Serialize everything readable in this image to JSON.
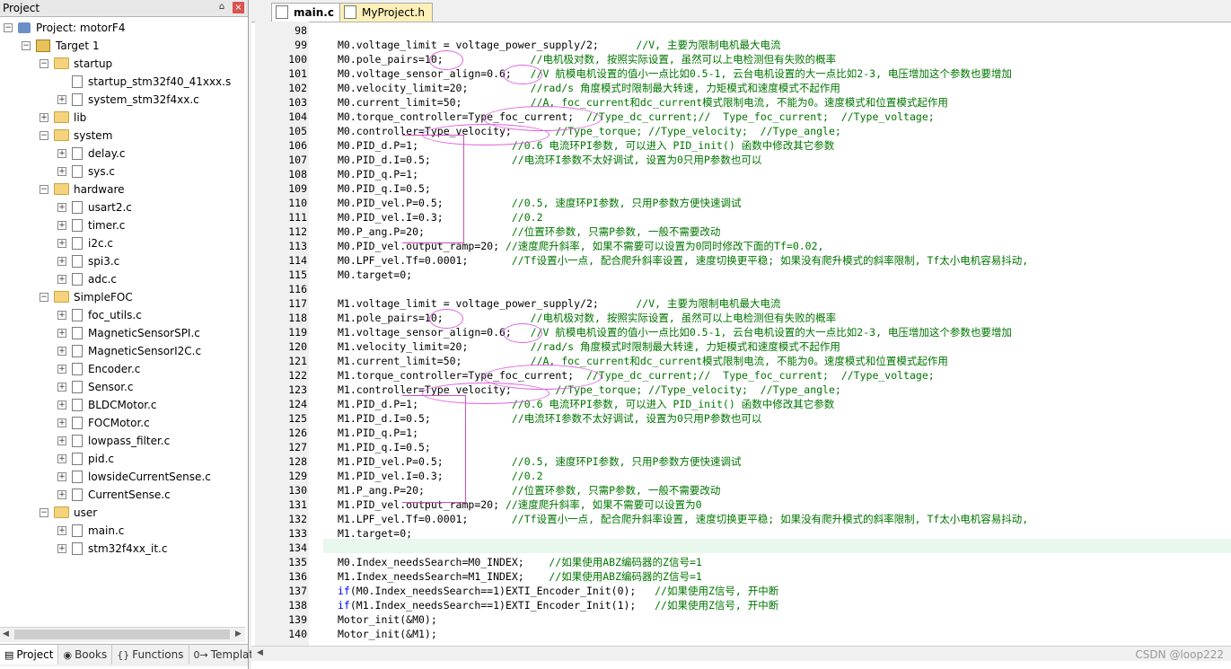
{
  "project_panel": {
    "title": "Project",
    "pin_label": "⌂",
    "close_label": "×",
    "tree": [
      {
        "level": 0,
        "type": "project",
        "label": "Project: motorF4",
        "toggle": "-"
      },
      {
        "level": 1,
        "type": "target",
        "label": "Target 1",
        "toggle": "-"
      },
      {
        "level": 2,
        "type": "folder",
        "label": "startup",
        "toggle": "-"
      },
      {
        "level": 3,
        "type": "file",
        "label": "startup_stm32f40_41xxx.s",
        "toggle": ""
      },
      {
        "level": 3,
        "type": "file",
        "label": "system_stm32f4xx.c",
        "toggle": "+"
      },
      {
        "level": 2,
        "type": "folder",
        "label": "lib",
        "toggle": "+"
      },
      {
        "level": 2,
        "type": "folder",
        "label": "system",
        "toggle": "-"
      },
      {
        "level": 3,
        "type": "file",
        "label": "delay.c",
        "toggle": "+"
      },
      {
        "level": 3,
        "type": "file",
        "label": "sys.c",
        "toggle": "+"
      },
      {
        "level": 2,
        "type": "folder",
        "label": "hardware",
        "toggle": "-"
      },
      {
        "level": 3,
        "type": "file",
        "label": "usart2.c",
        "toggle": "+"
      },
      {
        "level": 3,
        "type": "file",
        "label": "timer.c",
        "toggle": "+"
      },
      {
        "level": 3,
        "type": "file",
        "label": "i2c.c",
        "toggle": "+"
      },
      {
        "level": 3,
        "type": "file",
        "label": "spi3.c",
        "toggle": "+"
      },
      {
        "level": 3,
        "type": "file",
        "label": "adc.c",
        "toggle": "+"
      },
      {
        "level": 2,
        "type": "folder",
        "label": "SimpleFOC",
        "toggle": "-"
      },
      {
        "level": 3,
        "type": "file",
        "label": "foc_utils.c",
        "toggle": "+"
      },
      {
        "level": 3,
        "type": "file",
        "label": "MagneticSensorSPI.c",
        "toggle": "+"
      },
      {
        "level": 3,
        "type": "file",
        "label": "MagneticSensorI2C.c",
        "toggle": "+"
      },
      {
        "level": 3,
        "type": "file",
        "label": "Encoder.c",
        "toggle": "+"
      },
      {
        "level": 3,
        "type": "file",
        "label": "Sensor.c",
        "toggle": "+"
      },
      {
        "level": 3,
        "type": "file",
        "label": "BLDCMotor.c",
        "toggle": "+"
      },
      {
        "level": 3,
        "type": "file",
        "label": "FOCMotor.c",
        "toggle": "+"
      },
      {
        "level": 3,
        "type": "file",
        "label": "lowpass_filter.c",
        "toggle": "+"
      },
      {
        "level": 3,
        "type": "file",
        "label": "pid.c",
        "toggle": "+"
      },
      {
        "level": 3,
        "type": "file",
        "label": "lowsideCurrentSense.c",
        "toggle": "+"
      },
      {
        "level": 3,
        "type": "file",
        "label": "CurrentSense.c",
        "toggle": "+"
      },
      {
        "level": 2,
        "type": "folder",
        "label": "user",
        "toggle": "-"
      },
      {
        "level": 3,
        "type": "file",
        "label": "main.c",
        "toggle": "+"
      },
      {
        "level": 3,
        "type": "file",
        "label": "stm32f4xx_it.c",
        "toggle": "+"
      }
    ],
    "bottom_tabs": [
      {
        "icon": "▤",
        "label": "Project"
      },
      {
        "icon": "◉",
        "label": "Books"
      },
      {
        "icon": "{}",
        "label": "Functions"
      },
      {
        "icon": "0→",
        "label": "Templates"
      }
    ]
  },
  "editor": {
    "tabs": [
      {
        "label": "main.c",
        "active": true
      },
      {
        "label": "MyProject.h",
        "active": false
      }
    ],
    "lines": [
      {
        "n": "98",
        "segs": []
      },
      {
        "n": "99",
        "segs": [
          [
            "t",
            "M0.voltage_limit = voltage_power_supply/2;      "
          ],
          [
            "c",
            "//V, 主要为限制电机最大电流"
          ]
        ]
      },
      {
        "n": "100",
        "segs": [
          [
            "t",
            "M0.pole_pairs=10;              "
          ],
          [
            "c",
            "//电机极对数, 按照实际设置, 虽然可以上电检测但有失败的概率"
          ]
        ]
      },
      {
        "n": "101",
        "segs": [
          [
            "t",
            "M0.voltage_sensor_align=0.6;   "
          ],
          [
            "c",
            "//V 航模电机设置的值小一点比如0.5-1, 云台电机设置的大一点比如2-3, 电压增加这个参数也要增加"
          ]
        ]
      },
      {
        "n": "102",
        "segs": [
          [
            "t",
            "M0.velocity_limit=20;          "
          ],
          [
            "c",
            "//rad/s 角度模式时限制最大转速, 力矩模式和速度模式不起作用"
          ]
        ]
      },
      {
        "n": "103",
        "segs": [
          [
            "t",
            "M0.current_limit=50;           "
          ],
          [
            "c",
            "//A, foc_current和dc_current模式限制电流, 不能为0。速度模式和位置模式起作用"
          ]
        ]
      },
      {
        "n": "104",
        "segs": [
          [
            "t",
            "M0.torque_controller=Type_foc_current;  "
          ],
          [
            "c",
            "//Type_dc_current;//  Type_foc_current;  //Type_voltage;"
          ]
        ]
      },
      {
        "n": "105",
        "segs": [
          [
            "t",
            "M0.controller=Type_velocity;       "
          ],
          [
            "c",
            "//Type_torque; //Type_velocity;  //Type_angle;"
          ]
        ]
      },
      {
        "n": "106",
        "segs": [
          [
            "t",
            "M0.PID_d.P=1;               "
          ],
          [
            "c",
            "//0.6 电流环PI参数, 可以进入 PID_init() 函数中修改其它参数"
          ]
        ]
      },
      {
        "n": "107",
        "segs": [
          [
            "t",
            "M0.PID_d.I=0.5;             "
          ],
          [
            "c",
            "//电流环I参数不太好调试, 设置为0只用P参数也可以"
          ]
        ]
      },
      {
        "n": "108",
        "segs": [
          [
            "t",
            "M0.PID_q.P=1;"
          ]
        ]
      },
      {
        "n": "109",
        "segs": [
          [
            "t",
            "M0.PID_q.I=0.5;"
          ]
        ]
      },
      {
        "n": "110",
        "segs": [
          [
            "t",
            "M0.PID_vel.P=0.5;           "
          ],
          [
            "c",
            "//0.5, 速度环PI参数, 只用P参数方便快速调试"
          ]
        ]
      },
      {
        "n": "111",
        "segs": [
          [
            "t",
            "M0.PID_vel.I=0.3;           "
          ],
          [
            "c",
            "//0.2"
          ]
        ]
      },
      {
        "n": "112",
        "segs": [
          [
            "t",
            "M0.P_ang.P=20;              "
          ],
          [
            "c",
            "//位置环参数, 只需P参数, 一般不需要改动"
          ]
        ]
      },
      {
        "n": "113",
        "segs": [
          [
            "t",
            "M0.PID_vel.output_ramp=20; "
          ],
          [
            "c",
            "//速度爬升斜率, 如果不需要可以设置为0同时修改下面的Tf=0.02,"
          ]
        ]
      },
      {
        "n": "114",
        "segs": [
          [
            "t",
            "M0.LPF_vel.Tf=0.0001;       "
          ],
          [
            "c",
            "//Tf设置小一点, 配合爬升斜率设置, 速度切换更平稳; 如果没有爬升模式的斜率限制, Tf太小电机容易抖动,"
          ]
        ]
      },
      {
        "n": "115",
        "segs": [
          [
            "t",
            "M0.target=0;"
          ]
        ]
      },
      {
        "n": "116",
        "segs": []
      },
      {
        "n": "117",
        "segs": [
          [
            "t",
            "M1.voltage_limit = voltage_power_supply/2;      "
          ],
          [
            "c",
            "//V, 主要为限制电机最大电流"
          ]
        ]
      },
      {
        "n": "118",
        "segs": [
          [
            "t",
            "M1.pole_pairs=10;              "
          ],
          [
            "c",
            "//电机极对数, 按照实际设置, 虽然可以上电检测但有失败的概率"
          ]
        ]
      },
      {
        "n": "119",
        "segs": [
          [
            "t",
            "M1.voltage_sensor_align=0.6;   "
          ],
          [
            "c",
            "//V 航模电机设置的值小一点比如0.5-1, 云台电机设置的大一点比如2-3, 电压增加这个参数也要增加"
          ]
        ]
      },
      {
        "n": "120",
        "segs": [
          [
            "t",
            "M1.velocity_limit=20;          "
          ],
          [
            "c",
            "//rad/s 角度模式时限制最大转速, 力矩模式和速度模式不起作用"
          ]
        ]
      },
      {
        "n": "121",
        "segs": [
          [
            "t",
            "M1.current_limit=50;           "
          ],
          [
            "c",
            "//A, foc_current和dc_current模式限制电流, 不能为0。速度模式和位置模式起作用"
          ]
        ]
      },
      {
        "n": "122",
        "segs": [
          [
            "t",
            "M1.torque_controller=Type_foc_current;  "
          ],
          [
            "c",
            "//Type_dc_current;//  Type_foc_current;  //Type_voltage;"
          ]
        ]
      },
      {
        "n": "123",
        "segs": [
          [
            "t",
            "M1.controller=Type_velocity;       "
          ],
          [
            "c",
            "//Type_torque; //Type_velocity;  //Type_angle;"
          ]
        ]
      },
      {
        "n": "124",
        "segs": [
          [
            "t",
            "M1.PID_d.P=1;               "
          ],
          [
            "c",
            "//0.6 电流环PI参数, 可以进入 PID_init() 函数中修改其它参数"
          ]
        ]
      },
      {
        "n": "125",
        "segs": [
          [
            "t",
            "M1.PID_d.I=0.5;             "
          ],
          [
            "c",
            "//电流环I参数不太好调试, 设置为0只用P参数也可以"
          ]
        ]
      },
      {
        "n": "126",
        "segs": [
          [
            "t",
            "M1.PID_q.P=1;"
          ]
        ]
      },
      {
        "n": "127",
        "segs": [
          [
            "t",
            "M1.PID_q.I=0.5;"
          ]
        ]
      },
      {
        "n": "128",
        "segs": [
          [
            "t",
            "M1.PID_vel.P=0.5;           "
          ],
          [
            "c",
            "//0.5, 速度环PI参数, 只用P参数方便快速调试"
          ]
        ]
      },
      {
        "n": "129",
        "segs": [
          [
            "t",
            "M1.PID_vel.I=0.3;           "
          ],
          [
            "c",
            "//0.2"
          ]
        ]
      },
      {
        "n": "130",
        "segs": [
          [
            "t",
            "M1.P_ang.P=20;              "
          ],
          [
            "c",
            "//位置环参数, 只需P参数, 一般不需要改动"
          ]
        ]
      },
      {
        "n": "131",
        "segs": [
          [
            "t",
            "M1.PID_vel.output_ramp=20; "
          ],
          [
            "c",
            "//速度爬升斜率, 如果不需要可以设置为0"
          ]
        ]
      },
      {
        "n": "132",
        "segs": [
          [
            "t",
            "M1.LPF_vel.Tf=0.0001;       "
          ],
          [
            "c",
            "//Tf设置小一点, 配合爬升斜率设置, 速度切换更平稳; 如果没有爬升模式的斜率限制, Tf太小电机容易抖动,"
          ]
        ]
      },
      {
        "n": "133",
        "segs": [
          [
            "t",
            "M1.target=0;"
          ]
        ]
      },
      {
        "n": "134",
        "segs": []
      },
      {
        "n": "135",
        "segs": [
          [
            "t",
            "M0.Index_needsSearch=M0_INDEX;    "
          ],
          [
            "c",
            "//如果使用ABZ编码器的Z信号=1"
          ]
        ]
      },
      {
        "n": "136",
        "segs": [
          [
            "t",
            "M1.Index_needsSearch=M1_INDEX;    "
          ],
          [
            "c",
            "//如果使用ABZ编码器的Z信号=1"
          ]
        ]
      },
      {
        "n": "137",
        "segs": [
          [
            "k",
            "if"
          ],
          [
            "t",
            "(M0.Index_needsSearch==1)EXTI_Encoder_Init(0);   "
          ],
          [
            "c",
            "//如果使用Z信号, 开中断"
          ]
        ]
      },
      {
        "n": "138",
        "segs": [
          [
            "k",
            "if"
          ],
          [
            "t",
            "(M1.Index_needsSearch==1)EXTI_Encoder_Init(1);   "
          ],
          [
            "c",
            "//如果使用Z信号, 开中断"
          ]
        ]
      },
      {
        "n": "139",
        "segs": [
          [
            "t",
            "Motor_init(&M0);"
          ]
        ]
      },
      {
        "n": "140",
        "segs": [
          [
            "t",
            "Motor_init(&M1);"
          ]
        ]
      }
    ],
    "current_line": "133"
  },
  "watermark": "CSDN @loop222",
  "colors": {
    "comment": "#007500",
    "keyword": "#0000ff",
    "annotation": "#e060e0",
    "current_line_bg": "#e8f8ec",
    "inactive_tab_bg": "#fdf0b8"
  }
}
